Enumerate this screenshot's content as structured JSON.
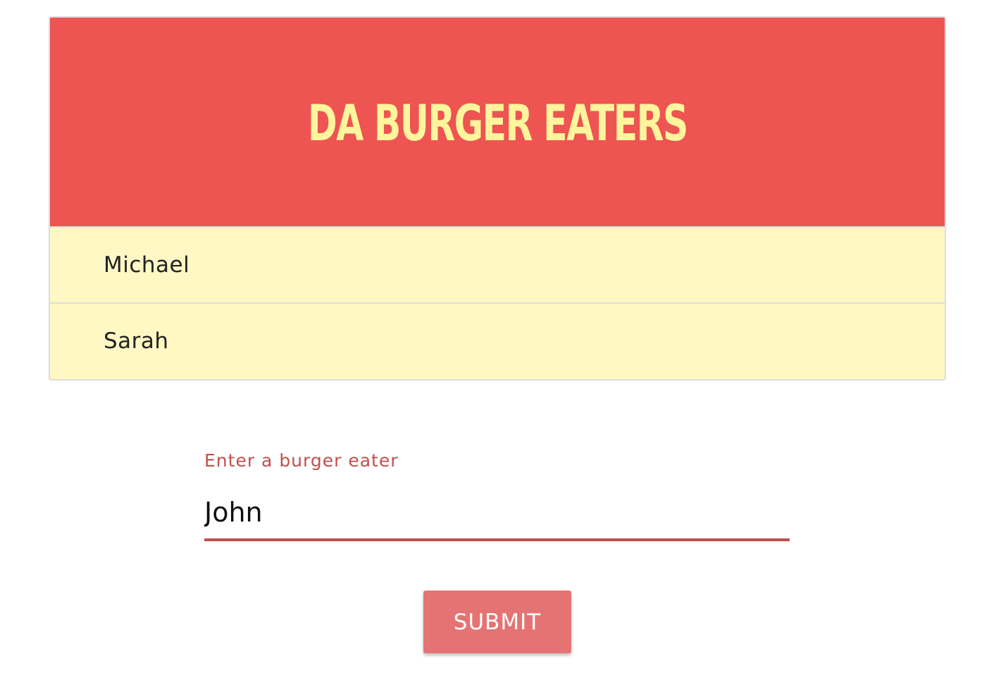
{
  "header": {
    "title": "DA BURGER EATERS"
  },
  "eaters": [
    {
      "name": "Michael"
    },
    {
      "name": "Sarah"
    }
  ],
  "form": {
    "label": "Enter a burger eater",
    "input_value": "John",
    "submit_label": "SUBMIT"
  },
  "colors": {
    "header_bg": "#ee5451",
    "title": "#fff59d",
    "list_bg": "#fff8c4",
    "accent": "#c0504d",
    "button_bg": "#e57373"
  }
}
